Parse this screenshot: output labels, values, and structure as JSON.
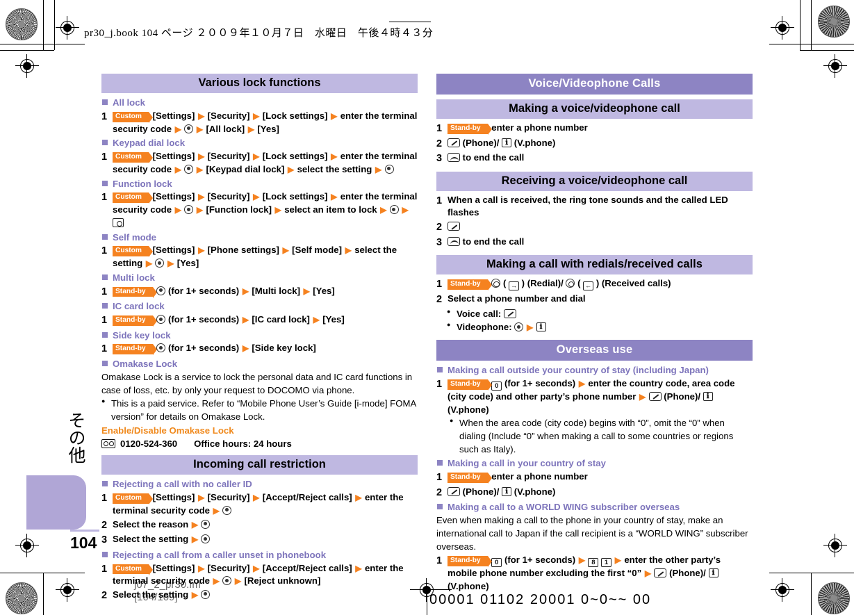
{
  "print_marks": {
    "book_slug": "pr30_j.book   104 ページ   ２００９年１０月７日　水曜日　午後４時４３分",
    "fm_file": "j07_2_pr30.fm",
    "fm_range": "[104/109]",
    "plate_slug": "00001 01102 20001 0~0~~ 00"
  },
  "side_tab": {
    "label": "その他"
  },
  "page_number": "104",
  "left_column": {
    "section_title": "Various lock functions",
    "blocks": [
      {
        "subhead": "All lock",
        "step_num": "1",
        "segments": [
          {
            "type": "tag",
            "text": "Custom"
          },
          {
            "type": "text",
            "text": "[Settings]"
          },
          {
            "type": "arrow"
          },
          {
            "type": "text",
            "text": "[Security]"
          },
          {
            "type": "arrow"
          },
          {
            "type": "text",
            "text": "[Lock settings]"
          },
          {
            "type": "arrow"
          },
          {
            "type": "text",
            "text": "enter the terminal security code"
          },
          {
            "type": "arrow"
          },
          {
            "type": "key",
            "icon": "select-key"
          },
          {
            "type": "arrow"
          },
          {
            "type": "text",
            "text": "[All lock]"
          },
          {
            "type": "arrow"
          },
          {
            "type": "text",
            "text": "[Yes]"
          }
        ]
      },
      {
        "subhead": "Keypad dial lock",
        "step_num": "1",
        "segments": [
          {
            "type": "tag",
            "text": "Custom"
          },
          {
            "type": "text",
            "text": "[Settings]"
          },
          {
            "type": "arrow"
          },
          {
            "type": "text",
            "text": "[Security]"
          },
          {
            "type": "arrow"
          },
          {
            "type": "text",
            "text": "[Lock settings]"
          },
          {
            "type": "arrow"
          },
          {
            "type": "text",
            "text": "enter the terminal security code"
          },
          {
            "type": "arrow"
          },
          {
            "type": "key",
            "icon": "select-key"
          },
          {
            "type": "arrow"
          },
          {
            "type": "text",
            "text": "[Keypad dial lock]"
          },
          {
            "type": "arrow"
          },
          {
            "type": "text",
            "text": "select the setting"
          },
          {
            "type": "arrow"
          },
          {
            "type": "key",
            "icon": "select-key"
          }
        ]
      },
      {
        "subhead": "Function lock",
        "step_num": "1",
        "segments": [
          {
            "type": "tag",
            "text": "Custom"
          },
          {
            "type": "text",
            "text": "[Settings]"
          },
          {
            "type": "arrow"
          },
          {
            "type": "text",
            "text": "[Security]"
          },
          {
            "type": "arrow"
          },
          {
            "type": "text",
            "text": "[Lock settings]"
          },
          {
            "type": "arrow"
          },
          {
            "type": "text",
            "text": "enter the terminal security code"
          },
          {
            "type": "arrow"
          },
          {
            "type": "key",
            "icon": "select-key"
          },
          {
            "type": "arrow"
          },
          {
            "type": "text",
            "text": "[Function lock]"
          },
          {
            "type": "arrow"
          },
          {
            "type": "text",
            "text": "select an item to lock"
          },
          {
            "type": "arrow"
          },
          {
            "type": "key",
            "icon": "select-key"
          },
          {
            "type": "arrow"
          },
          {
            "type": "key",
            "icon": "camera-key"
          }
        ]
      },
      {
        "subhead": "Self mode",
        "step_num": "1",
        "segments": [
          {
            "type": "tag",
            "text": "Custom"
          },
          {
            "type": "text",
            "text": "[Settings]"
          },
          {
            "type": "arrow"
          },
          {
            "type": "text",
            "text": "[Phone settings]"
          },
          {
            "type": "arrow"
          },
          {
            "type": "text",
            "text": "[Self mode]"
          },
          {
            "type": "arrow"
          },
          {
            "type": "text",
            "text": "select the setting"
          },
          {
            "type": "arrow"
          },
          {
            "type": "key",
            "icon": "select-key"
          },
          {
            "type": "arrow"
          },
          {
            "type": "text",
            "text": "[Yes]"
          }
        ]
      },
      {
        "subhead": "Multi lock",
        "step_num": "1",
        "segments": [
          {
            "type": "tag",
            "text": "Stand-by"
          },
          {
            "type": "key",
            "icon": "select-key"
          },
          {
            "type": "text",
            "text": "(for 1+ seconds)"
          },
          {
            "type": "arrow"
          },
          {
            "type": "text",
            "text": "[Multi lock]"
          },
          {
            "type": "arrow"
          },
          {
            "type": "text",
            "text": "[Yes]"
          }
        ]
      },
      {
        "subhead": "IC card lock",
        "step_num": "1",
        "segments": [
          {
            "type": "tag",
            "text": "Stand-by"
          },
          {
            "type": "key",
            "icon": "select-key"
          },
          {
            "type": "text",
            "text": "(for 1+ seconds)"
          },
          {
            "type": "arrow"
          },
          {
            "type": "text",
            "text": "[IC card lock]"
          },
          {
            "type": "arrow"
          },
          {
            "type": "text",
            "text": "[Yes]"
          }
        ]
      },
      {
        "subhead": "Side key lock",
        "step_num": "1",
        "segments": [
          {
            "type": "tag",
            "text": "Stand-by"
          },
          {
            "type": "key",
            "icon": "select-key"
          },
          {
            "type": "text",
            "text": "(for 1+ seconds)"
          },
          {
            "type": "arrow"
          },
          {
            "type": "text",
            "text": "[Side key lock]"
          }
        ]
      }
    ],
    "omakase": {
      "subhead": "Omakase Lock",
      "paragraph": "Omakase Lock is a service to lock the personal data and IC card functions in case of loss, etc. by only your request to DOCOMO via phone.",
      "bullet": "This is a paid service. Refer to “Mobile Phone User’s Guide [i-mode] FOMA version” for details on Omakase Lock.",
      "orange_head": "Enable/Disable Omakase Lock",
      "tel_number": "0120-524-360",
      "tel_hours": "Office hours: 24 hours"
    },
    "section2_title": "Incoming call restriction",
    "blocks2": [
      {
        "subhead": "Rejecting a call with no caller ID",
        "steps": [
          {
            "num": "1",
            "segments": [
              {
                "type": "tag",
                "text": "Custom"
              },
              {
                "type": "text",
                "text": "[Settings]"
              },
              {
                "type": "arrow"
              },
              {
                "type": "text",
                "text": "[Security]"
              },
              {
                "type": "arrow"
              },
              {
                "type": "text",
                "text": "[Accept/Reject calls]"
              },
              {
                "type": "arrow"
              },
              {
                "type": "text",
                "text": "enter the terminal security code"
              },
              {
                "type": "arrow"
              },
              {
                "type": "key",
                "icon": "select-key"
              }
            ]
          },
          {
            "num": "2",
            "segments": [
              {
                "type": "text",
                "text": "Select the reason"
              },
              {
                "type": "arrow"
              },
              {
                "type": "key",
                "icon": "select-key"
              }
            ]
          },
          {
            "num": "3",
            "segments": [
              {
                "type": "text",
                "text": "Select the setting"
              },
              {
                "type": "arrow"
              },
              {
                "type": "key",
                "icon": "select-key"
              }
            ]
          }
        ]
      },
      {
        "subhead": "Rejecting a call from a caller unset in phonebook",
        "steps": [
          {
            "num": "1",
            "segments": [
              {
                "type": "tag",
                "text": "Custom"
              },
              {
                "type": "text",
                "text": "[Settings]"
              },
              {
                "type": "arrow"
              },
              {
                "type": "text",
                "text": "[Security]"
              },
              {
                "type": "arrow"
              },
              {
                "type": "text",
                "text": "[Accept/Reject calls]"
              },
              {
                "type": "arrow"
              },
              {
                "type": "text",
                "text": "enter the terminal security code"
              },
              {
                "type": "arrow"
              },
              {
                "type": "key",
                "icon": "select-key"
              },
              {
                "type": "arrow"
              },
              {
                "type": "text",
                "text": "[Reject unknown]"
              }
            ]
          },
          {
            "num": "2",
            "segments": [
              {
                "type": "text",
                "text": "Select the setting"
              },
              {
                "type": "arrow"
              },
              {
                "type": "key",
                "icon": "select-key"
              }
            ]
          }
        ]
      }
    ]
  },
  "right_column": {
    "chapter_title": "Voice/Videophone Calls",
    "section1_title": "Making a voice/videophone call",
    "section1_steps": [
      {
        "num": "1",
        "segments": [
          {
            "type": "tag",
            "text": "Stand-by"
          },
          {
            "type": "text",
            "text": "enter a phone number"
          }
        ]
      },
      {
        "num": "2",
        "segments": [
          {
            "type": "key",
            "icon": "send-key"
          },
          {
            "type": "text",
            "text": "(Phone)/"
          },
          {
            "type": "key",
            "icon": "videophone-key"
          },
          {
            "type": "text",
            "text": "(V.phone)"
          }
        ]
      },
      {
        "num": "3",
        "segments": [
          {
            "type": "key",
            "icon": "end-key"
          },
          {
            "type": "text",
            "text": "to end the call"
          }
        ]
      }
    ],
    "section2_title": "Receiving a voice/videophone call",
    "section2_steps": [
      {
        "num": "1",
        "segments": [
          {
            "type": "text",
            "text": "When a call is received, the ring tone sounds and the called LED flashes"
          }
        ]
      },
      {
        "num": "2",
        "segments": [
          {
            "type": "key",
            "icon": "send-key"
          }
        ]
      },
      {
        "num": "3",
        "segments": [
          {
            "type": "key",
            "icon": "end-key"
          },
          {
            "type": "text",
            "text": "to end the call"
          }
        ]
      }
    ],
    "section3_title": "Making a call with redials/received calls",
    "section3_steps": [
      {
        "num": "1",
        "segments": [
          {
            "type": "tag",
            "text": "Stand-by"
          },
          {
            "type": "key",
            "icon": "scroll-up-key"
          },
          {
            "type": "text",
            "text": "("
          },
          {
            "type": "key",
            "icon": "redial-key"
          },
          {
            "type": "text",
            "text": ") (Redial)/"
          },
          {
            "type": "key",
            "icon": "scroll-down-key"
          },
          {
            "type": "text",
            "text": "("
          },
          {
            "type": "key",
            "icon": "received-calls-key"
          },
          {
            "type": "text",
            "text": ") (Received calls)"
          }
        ]
      },
      {
        "num": "2",
        "segments": [
          {
            "type": "text",
            "text": "Select a phone number and dial"
          }
        ]
      }
    ],
    "section3_bullets": [
      {
        "segments": [
          {
            "type": "text",
            "text": "Voice call: "
          },
          {
            "type": "key",
            "icon": "send-key"
          }
        ]
      },
      {
        "segments": [
          {
            "type": "text",
            "text": "Videophone: "
          },
          {
            "type": "key",
            "icon": "select-key"
          },
          {
            "type": "arrow"
          },
          {
            "type": "key",
            "icon": "videophone-key"
          }
        ]
      }
    ],
    "chapter2_title": "Overseas use",
    "overseas": [
      {
        "subhead": "Making a call outside your country of stay (including Japan)",
        "steps": [
          {
            "num": "1",
            "segments": [
              {
                "type": "tag",
                "text": "Stand-by"
              },
              {
                "type": "key",
                "icon": "key-0"
              },
              {
                "type": "text",
                "text": "(for 1+ seconds)"
              },
              {
                "type": "arrow"
              },
              {
                "type": "text",
                "text": "enter the country code, area code (city code) and other party’s phone number"
              },
              {
                "type": "arrow"
              },
              {
                "type": "key",
                "icon": "send-key"
              },
              {
                "type": "text",
                "text": "(Phone)/"
              },
              {
                "type": "key",
                "icon": "videophone-key"
              },
              {
                "type": "text",
                "text": "(V.phone)"
              }
            ]
          }
        ],
        "bullet": "When the area code (city code) begins with “0”, omit the “0” when dialing (Include “0” when making a call to some countries or regions such as Italy)."
      },
      {
        "subhead": "Making a call in your country of stay",
        "steps": [
          {
            "num": "1",
            "segments": [
              {
                "type": "tag",
                "text": "Stand-by"
              },
              {
                "type": "text",
                "text": "enter a phone number"
              }
            ]
          },
          {
            "num": "2",
            "segments": [
              {
                "type": "key",
                "icon": "send-key"
              },
              {
                "type": "text",
                "text": "(Phone)/"
              },
              {
                "type": "key",
                "icon": "videophone-key"
              },
              {
                "type": "text",
                "text": "(V.phone)"
              }
            ]
          }
        ]
      },
      {
        "subhead": "Making a call to a WORLD WING subscriber overseas",
        "paragraph": "Even when making a call to the phone in your country of stay, make an international call to Japan if the call recipient is a “WORLD WING” subscriber overseas.",
        "steps": [
          {
            "num": "1",
            "segments": [
              {
                "type": "tag",
                "text": "Stand-by"
              },
              {
                "type": "key",
                "icon": "key-0"
              },
              {
                "type": "text",
                "text": "(for 1+ seconds)"
              },
              {
                "type": "arrow"
              },
              {
                "type": "key",
                "icon": "key-8"
              },
              {
                "type": "key",
                "icon": "key-1"
              },
              {
                "type": "arrow"
              },
              {
                "type": "text",
                "text": "enter the other party’s mobile phone number excluding the first “0”"
              },
              {
                "type": "arrow"
              },
              {
                "type": "key",
                "icon": "send-key"
              },
              {
                "type": "text",
                "text": "(Phone)/"
              },
              {
                "type": "key",
                "icon": "videophone-key"
              },
              {
                "type": "text",
                "text": "(V.phone)"
              }
            ]
          }
        ]
      }
    ]
  },
  "colors": {
    "chapter_bar": "#8d84c3",
    "section_bar": "#bfb8e1",
    "subhead": "#7d74bb",
    "accent_orange": "#f58220",
    "orange_head": "#f08a1e",
    "side_tab": "#b0a6d6"
  }
}
